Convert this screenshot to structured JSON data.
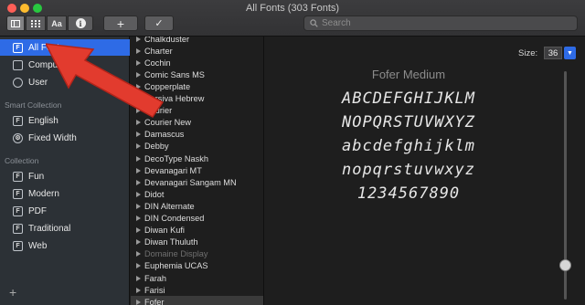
{
  "window": {
    "title": "All Fonts (303 Fonts)"
  },
  "toolbar": {
    "seg_font_label": "Aa",
    "info_label": "i",
    "add_label": "+",
    "check_label": "✓",
    "search_placeholder": "Search"
  },
  "sidebar": {
    "library_items": [
      {
        "label": "All Fonts",
        "icon": "font-book-icon"
      },
      {
        "label": "Computer",
        "icon": "computer-icon"
      },
      {
        "label": "User",
        "icon": "user-icon"
      }
    ],
    "smart_heading": "Smart Collection",
    "smart_items": [
      {
        "label": "English",
        "icon": "font-book-icon"
      },
      {
        "label": "Fixed Width",
        "icon": "gear-icon"
      }
    ],
    "collection_heading": "Collection",
    "collection_items": [
      {
        "label": "Fun",
        "icon": "font-book-icon"
      },
      {
        "label": "Modern",
        "icon": "font-book-icon"
      },
      {
        "label": "PDF",
        "icon": "font-book-icon"
      },
      {
        "label": "Traditional",
        "icon": "font-book-icon"
      },
      {
        "label": "Web",
        "icon": "font-book-icon"
      }
    ],
    "add_label": "+"
  },
  "fonts": [
    "Chalkduster",
    "Charter",
    "Cochin",
    "Comic Sans MS",
    "Copperplate",
    "Corsiva Hebrew",
    "Courier",
    "Courier New",
    "Damascus",
    "Debby",
    "DecoType Naskh",
    "Devanagari MT",
    "Devanagari Sangam MN",
    "Didot",
    "DIN Alternate",
    "DIN Condensed",
    "Diwan Kufi",
    "Diwan Thuluth",
    "Domaine Display",
    "Euphemia UCAS",
    "Farah",
    "Farisi",
    "Fofer"
  ],
  "fonts_disabled": [
    "Domaine Display"
  ],
  "preview": {
    "size_label": "Size:",
    "size_value": "36",
    "font_name": "Fofer Medium",
    "lines": [
      "ABCDEFGHIJKLM",
      "NOPQRSTUVWXYZ",
      "abcdefghijklm",
      "nopqrstuvwxyz",
      "1234567890"
    ]
  },
  "colors": {
    "accent": "#2e6be6",
    "annotation_arrow": "#e23b2e"
  }
}
